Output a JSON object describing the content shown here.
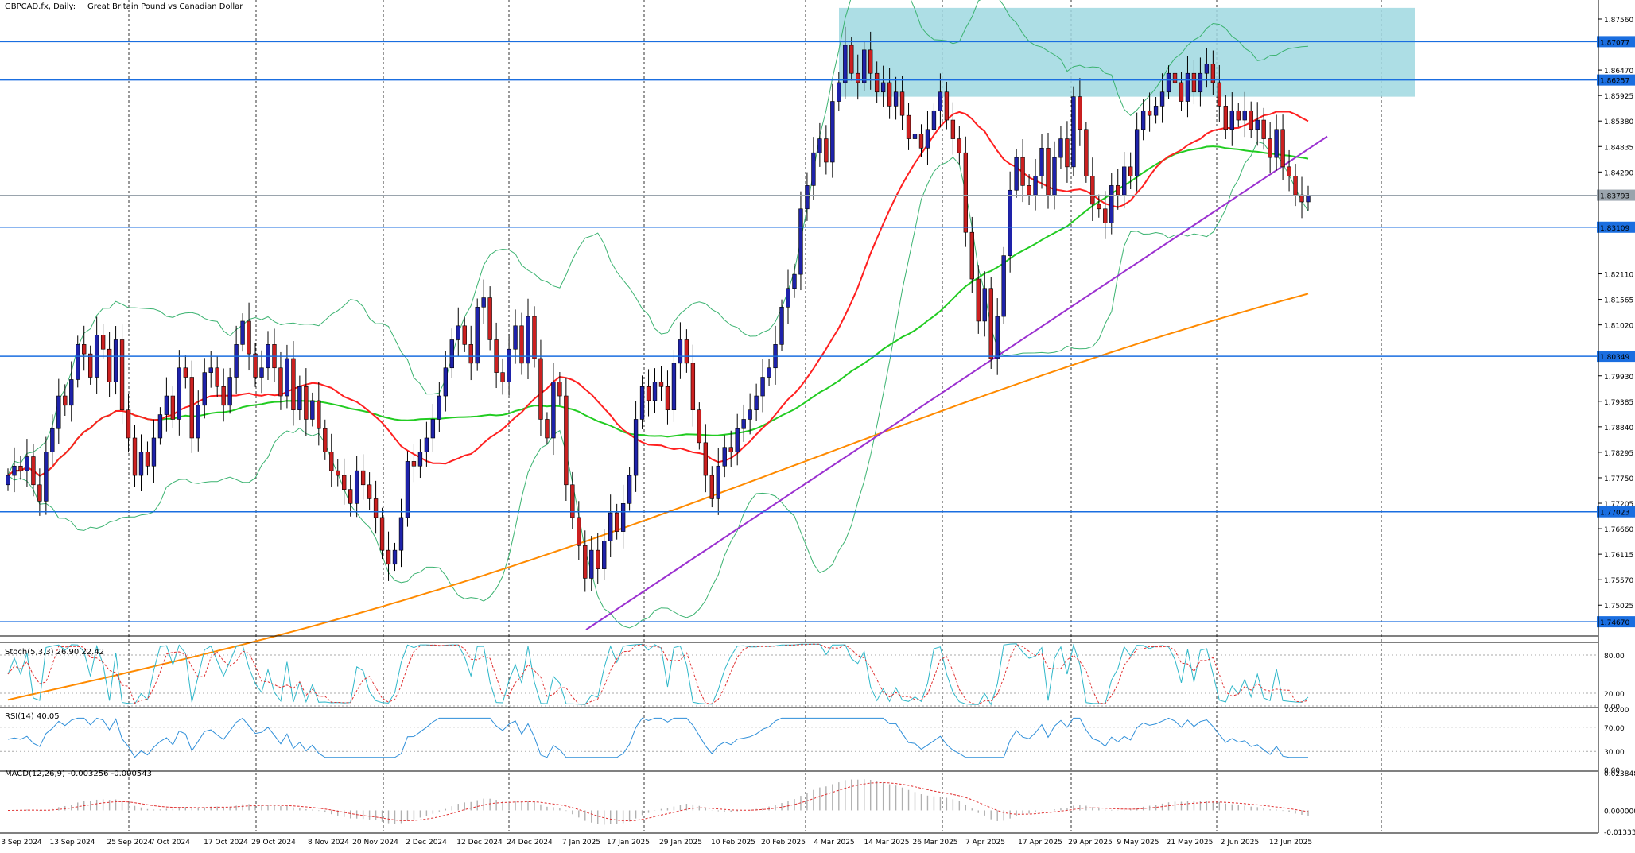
{
  "header": {
    "symbol": "GBPCAD.fx, Daily:",
    "description": "Great Britain Pound vs Canadian Dollar"
  },
  "colors": {
    "bull": "#1e22aa",
    "bear": "#cc2020",
    "ma_fast": "#ff2020",
    "ma_mid": "#22cc22",
    "ma_slow": "#ff8a00",
    "bands": "#3cb371",
    "trendline": "#9b30d0",
    "zone": "#9fd8e0",
    "level": "#1a6ee0",
    "price_tag": "#1a6ee0"
  },
  "indicators": {
    "stoch": "Stoch(5,3,3) 26.90 22.42",
    "rsi": "RSI(14) 40.05",
    "macd": "MACD(12,26,9) -0.003256 -0.000543"
  },
  "chart_data": {
    "type": "candlestick",
    "symbol": "GBPCAD",
    "timeframe": "Daily",
    "ylim": [
      1.744,
      1.879
    ],
    "y_ticks": [
      "1.87560",
      "1.86470",
      "1.85925",
      "1.85380",
      "1.84835",
      "1.84290",
      "1.82110",
      "1.81565",
      "1.81020",
      "1.79930",
      "1.79385",
      "1.78840",
      "1.78295",
      "1.77750",
      "1.77205",
      "1.76660",
      "1.76115",
      "1.75570",
      "1.75025"
    ],
    "x_ticks": [
      "3 Sep 2024",
      "13 Sep 2024",
      "25 Sep 2024",
      "7 Oct 2024",
      "17 Oct 2024",
      "29 Oct 2024",
      "8 Nov 2024",
      "20 Nov 2024",
      "2 Dec 2024",
      "12 Dec 2024",
      "24 Dec 2024",
      "7 Jan 2025",
      "17 Jan 2025",
      "29 Jan 2025",
      "10 Feb 2025",
      "20 Feb 2025",
      "4 Mar 2025",
      "14 Mar 2025",
      "26 Mar 2025",
      "7 Apr 2025",
      "17 Apr 2025",
      "29 Apr 2025",
      "9 May 2025",
      "21 May 2025",
      "2 Jun 2025",
      "12 Jun 2025"
    ],
    "horizontal_levels": [
      {
        "value": 1.87077,
        "label": "1.87077"
      },
      {
        "value": 1.86257,
        "label": "1.86257"
      },
      {
        "value": 1.83109,
        "label": "1.83109"
      },
      {
        "value": 1.80349,
        "label": "1.80349"
      },
      {
        "value": 1.77023,
        "label": "1.77023"
      },
      {
        "value": 1.7467,
        "label": "1.74670"
      }
    ],
    "current_price": {
      "value": 1.83793,
      "label": "1.83793"
    },
    "resistance_zone": {
      "from_date": "4 Mar 2025",
      "to_date": "after 12 Jun 2025",
      "low": 1.859,
      "high": 1.878
    },
    "trendline": {
      "from": {
        "date": "7 Jan 2025",
        "price": 1.745
      },
      "to": {
        "date": "after 12 Jun 2025",
        "price": 1.8505
      }
    },
    "closes": [
      1.778,
      1.78,
      1.779,
      1.782,
      1.776,
      1.7725,
      1.783,
      1.788,
      1.795,
      1.793,
      1.7985,
      1.806,
      1.804,
      1.799,
      1.808,
      1.805,
      1.798,
      1.807,
      1.792,
      1.786,
      1.778,
      1.783,
      1.78,
      1.786,
      1.791,
      1.795,
      1.79,
      1.801,
      1.799,
      1.786,
      1.793,
      1.8,
      1.801,
      1.797,
      1.793,
      1.799,
      1.806,
      1.811,
      1.804,
      1.799,
      1.801,
      1.806,
      1.801,
      1.795,
      1.803,
      1.792,
      1.797,
      1.79,
      1.794,
      1.788,
      1.783,
      1.779,
      1.778,
      1.775,
      1.772,
      1.779,
      1.776,
      1.773,
      1.769,
      1.762,
      1.759,
      1.762,
      1.769,
      1.781,
      1.78,
      1.783,
      1.786,
      1.79,
      1.795,
      1.801,
      1.807,
      1.81,
      1.806,
      1.802,
      1.814,
      1.816,
      1.807,
      1.8,
      1.798,
      1.805,
      1.81,
      1.802,
      1.812,
      1.803,
      1.79,
      1.786,
      1.798,
      1.795,
      1.776,
      1.769,
      1.763,
      1.756,
      1.762,
      1.758,
      1.764,
      1.77,
      1.766,
      1.772,
      1.778,
      1.79,
      1.797,
      1.794,
      1.798,
      1.797,
      1.792,
      1.802,
      1.807,
      1.802,
      1.792,
      1.785,
      1.778,
      1.773,
      1.78,
      1.784,
      1.783,
      1.788,
      1.79,
      1.792,
      1.795,
      1.799,
      1.801,
      1.806,
      1.814,
      1.818,
      1.821,
      1.835,
      1.84,
      1.847,
      1.85,
      1.845,
      1.858,
      1.862,
      1.87,
      1.864,
      1.862,
      1.869,
      1.864,
      1.86,
      1.862,
      1.857,
      1.86,
      1.855,
      1.85,
      1.851,
      1.848,
      1.852,
      1.856,
      1.86,
      1.854,
      1.85,
      1.847,
      1.83,
      1.82,
      1.811,
      1.818,
      1.803,
      1.812,
      1.825,
      1.839,
      1.846,
      1.84,
      1.838,
      1.842,
      1.848,
      1.838,
      1.846,
      1.85,
      1.844,
      1.859,
      1.852,
      1.842,
      1.836,
      1.835,
      1.832,
      1.84,
      1.838,
      1.844,
      1.842,
      1.852,
      1.856,
      1.855,
      1.857,
      1.86,
      1.864,
      1.862,
      1.858,
      1.864,
      1.86,
      1.864,
      1.866,
      1.862,
      1.857,
      1.852,
      1.856,
      1.854,
      1.856,
      1.852,
      1.854,
      1.85,
      1.846,
      1.852,
      1.844,
      1.842,
      1.838,
      1.8365,
      1.8379
    ]
  }
}
